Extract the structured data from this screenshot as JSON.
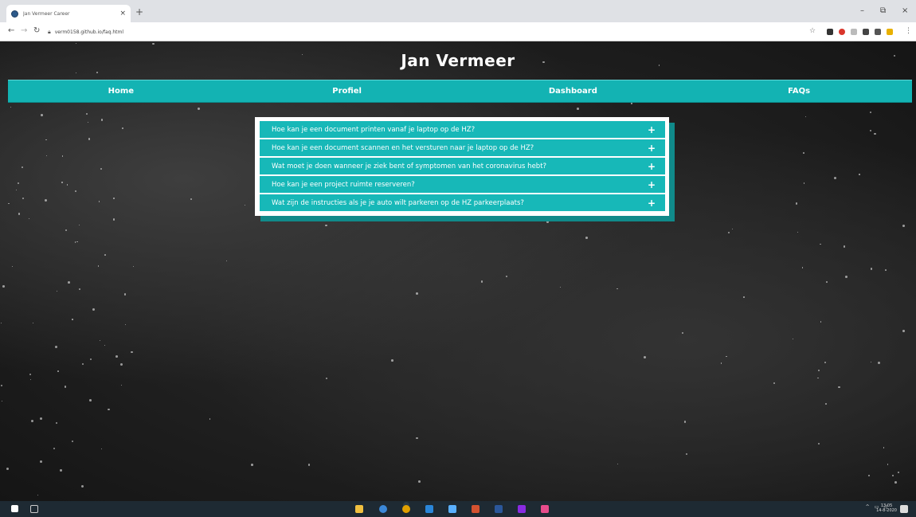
{
  "browser": {
    "tab_title": "Jan Vermeer Career",
    "tab_close": "×",
    "new_tab": "+",
    "address": "verm0158.github.io/faq.html",
    "window_controls": {
      "minimize": "–",
      "maximize": "⧉",
      "close": "×"
    }
  },
  "site": {
    "title": "Jan Vermeer",
    "nav": [
      "Home",
      "Profiel",
      "Dashboard",
      "FAQs"
    ],
    "accent_color": "#13b3b3"
  },
  "faq": [
    "Hoe kan je een document printen vanaf je laptop op de HZ?",
    "Hoe kan je een document scannen en het versturen naar je laptop op de HZ?",
    "Wat moet je doen wanneer je ziek bent of symptomen van het coronavirus hebt?",
    "Hoe kan je een project ruimte reserveren?",
    "Wat zijn de instructies als je je auto wilt parkeren op de HZ parkeerplaats?"
  ],
  "faq_expand_icon": "+",
  "taskbar": {
    "time": "13:05",
    "date": "14-8-2020"
  }
}
